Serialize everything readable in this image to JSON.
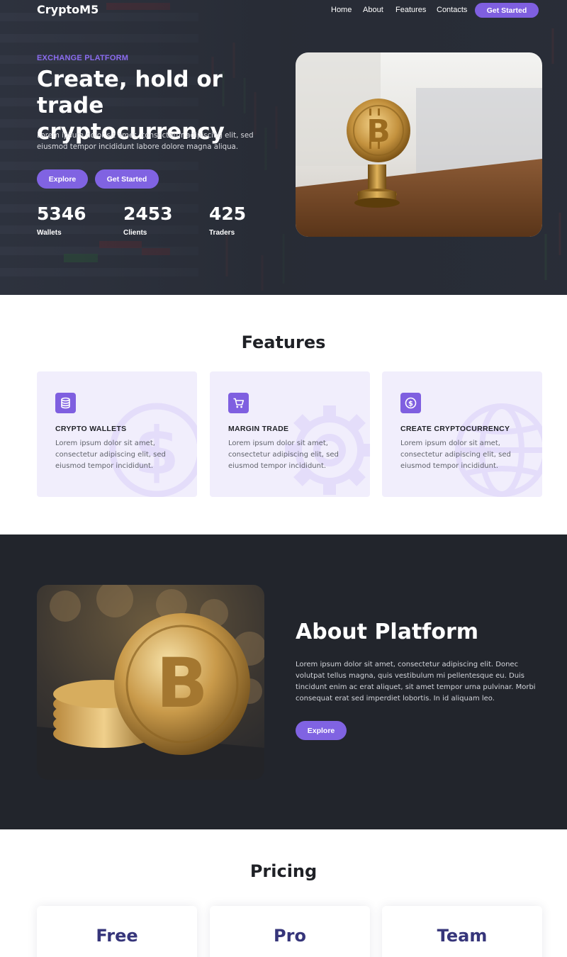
{
  "nav": {
    "logo": "CryptoM5",
    "links": [
      "Home",
      "About",
      "Features",
      "Contacts"
    ],
    "cta": "Get Started"
  },
  "hero": {
    "eyebrow": "EXCHANGE PLATFORM",
    "title": "Create, hold or trade cryptocurrency",
    "text": "Lorem ipsum dolor sit amet, consectetur adipiscing elit, sed eiusmod tempor incididunt labore dolore magna aliqua.",
    "buttons": [
      "Explore",
      "Get Started"
    ],
    "stats": [
      {
        "value": "5346",
        "label": "Wallets"
      },
      {
        "value": "2453",
        "label": "Clients"
      },
      {
        "value": "425",
        "label": "Traders"
      }
    ]
  },
  "features": {
    "title": "Features",
    "items": [
      {
        "title": "CRYPTO WALLETS",
        "text": "Lorem ipsum dolor sit amet, consectetur adipiscing elit, sed eiusmod tempor incididunt.",
        "icon": "database-icon"
      },
      {
        "title": "MARGIN TRADE",
        "text": "Lorem ipsum dolor sit amet, consectetur adipiscing elit, sed eiusmod tempor incididunt.",
        "icon": "cart-icon"
      },
      {
        "title": "CREATE CRYPTOCURRENCY",
        "text": "Lorem ipsum dolor sit amet, consectetur adipiscing elit, sed eiusmod tempor incididunt.",
        "icon": "dollar-coin-icon"
      }
    ]
  },
  "about": {
    "title": "About Platform",
    "text": "Lorem ipsum dolor sit amet, consectetur adipiscing elit. Donec volutpat tellus magna, quis vestibulum mi pellentesque eu. Duis tincidunt enim ac erat aliquet, sit amet tempor urna pulvinar. Morbi consequat erat sed imperdiet lobortis. In id aliquam leo.",
    "button": "Explore"
  },
  "pricing": {
    "title": "Pricing",
    "plans": [
      "Free",
      "Pro",
      "Team"
    ]
  },
  "colors": {
    "accent": "#7f5fe0",
    "dark": "#22252c",
    "feature_bg": "#f1eefc",
    "pricing_heading": "#36357a"
  }
}
